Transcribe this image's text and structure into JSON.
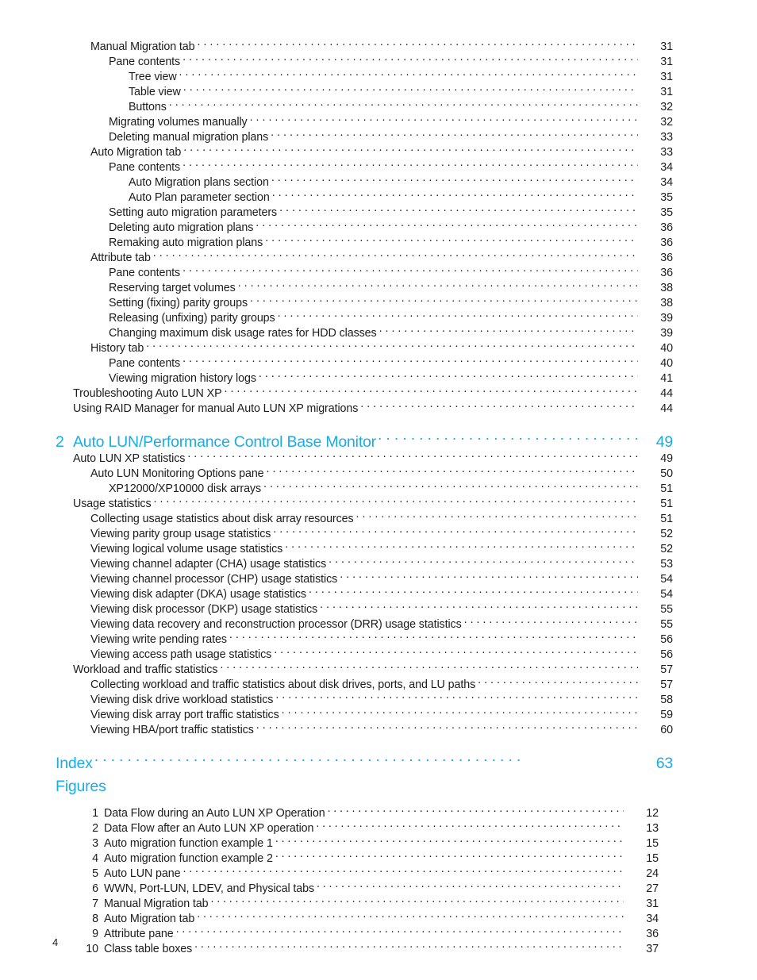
{
  "document": {
    "folio": "4",
    "accent_color": "#18AEE4",
    "text_color": "#1c1c1c"
  },
  "toc": {
    "entries": [
      {
        "level": 1,
        "label": "Manual Migration tab",
        "page": "31"
      },
      {
        "level": 2,
        "label": "Pane contents",
        "page": "31"
      },
      {
        "level": 3,
        "label": "Tree view",
        "page": "31"
      },
      {
        "level": 3,
        "label": "Table view",
        "page": "31"
      },
      {
        "level": 3,
        "label": "Buttons",
        "page": "32"
      },
      {
        "level": 2,
        "label": "Migrating volumes manually",
        "page": "32"
      },
      {
        "level": 2,
        "label": "Deleting manual migration plans",
        "page": "33"
      },
      {
        "level": 1,
        "label": "Auto Migration tab",
        "page": "33"
      },
      {
        "level": 2,
        "label": "Pane contents",
        "page": "34"
      },
      {
        "level": 3,
        "label": "Auto Migration plans section",
        "page": "34"
      },
      {
        "level": 3,
        "label": "Auto Plan parameter section",
        "page": "35"
      },
      {
        "level": 2,
        "label": "Setting auto migration parameters",
        "page": "35"
      },
      {
        "level": 2,
        "label": "Deleting auto migration plans",
        "page": "36"
      },
      {
        "level": 2,
        "label": "Remaking auto migration plans",
        "page": "36"
      },
      {
        "level": 1,
        "label": "Attribute tab",
        "page": "36"
      },
      {
        "level": 2,
        "label": "Pane contents",
        "page": "36"
      },
      {
        "level": 2,
        "label": "Reserving target volumes",
        "page": "38"
      },
      {
        "level": 2,
        "label": "Setting (fixing) parity groups",
        "page": "38"
      },
      {
        "level": 2,
        "label": "Releasing (unfixing) parity groups",
        "page": "39"
      },
      {
        "level": 2,
        "label": "Changing maximum disk usage rates for HDD classes",
        "page": "39"
      },
      {
        "level": 1,
        "label": "History tab",
        "page": "40"
      },
      {
        "level": 2,
        "label": "Pane contents",
        "page": "40"
      },
      {
        "level": 2,
        "label": "Viewing migration history logs",
        "page": "41"
      },
      {
        "level": 0,
        "label": "Troubleshooting Auto LUN XP",
        "page": "44"
      },
      {
        "level": 0,
        "label": "Using RAID Manager for manual Auto LUN XP migrations",
        "page": "44"
      }
    ],
    "chapter": {
      "number": "2",
      "label": "Auto LUN/Performance Control Base Monitor",
      "page": "49"
    },
    "entries2": [
      {
        "level": 0,
        "label": "Auto LUN XP statistics",
        "page": "49"
      },
      {
        "level": 1,
        "label": "Auto LUN Monitoring Options pane",
        "page": "50"
      },
      {
        "level": 2,
        "label": "XP12000/XP10000 disk arrays",
        "page": "51"
      },
      {
        "level": 0,
        "label": "Usage statistics",
        "page": "51"
      },
      {
        "level": 1,
        "label": "Collecting usage statistics about disk array resources",
        "page": "51"
      },
      {
        "level": 1,
        "label": "Viewing parity group usage statistics",
        "page": "52"
      },
      {
        "level": 1,
        "label": "Viewing logical volume usage statistics",
        "page": "52"
      },
      {
        "level": 1,
        "label": "Viewing channel adapter (CHA) usage statistics",
        "page": "53"
      },
      {
        "level": 1,
        "label": "Viewing channel processor (CHP) usage statistics",
        "page": "54"
      },
      {
        "level": 1,
        "label": "Viewing disk adapter (DKA) usage statistics",
        "page": "54"
      },
      {
        "level": 1,
        "label": "Viewing disk processor (DKP) usage statistics",
        "page": "55"
      },
      {
        "level": 1,
        "label": "Viewing data recovery and reconstruction processor (DRR) usage statistics",
        "page": "55"
      },
      {
        "level": 1,
        "label": "Viewing write pending rates",
        "page": "56"
      },
      {
        "level": 1,
        "label": "Viewing access path usage statistics",
        "page": "56"
      },
      {
        "level": 0,
        "label": "Workload and traffic statistics",
        "page": "57"
      },
      {
        "level": 1,
        "label": "Collecting workload and traffic statistics about disk drives, ports, and LU paths",
        "page": "57"
      },
      {
        "level": 1,
        "label": "Viewing disk drive workload statistics",
        "page": "58"
      },
      {
        "level": 1,
        "label": "Viewing disk array port traffic statistics",
        "page": "59"
      },
      {
        "level": 1,
        "label": "Viewing HBA/port traffic statistics",
        "page": "60"
      }
    ],
    "index": {
      "label": "Index",
      "page": "63"
    },
    "figures_heading": "Figures",
    "figures": [
      {
        "num": "1",
        "label": "Data Flow during an Auto LUN XP Operation",
        "page": "12"
      },
      {
        "num": "2",
        "label": "Data Flow after an Auto LUN XP operation",
        "page": "13"
      },
      {
        "num": "3",
        "label": "Auto migration function example 1",
        "page": "15"
      },
      {
        "num": "4",
        "label": "Auto migration function example 2",
        "page": "15"
      },
      {
        "num": "5",
        "label": "Auto LUN pane",
        "page": "24"
      },
      {
        "num": "6",
        "label": "WWN, Port-LUN, LDEV, and Physical tabs",
        "page": "27"
      },
      {
        "num": "7",
        "label": "Manual Migration tab",
        "page": "31"
      },
      {
        "num": "8",
        "label": "Auto Migration tab",
        "page": "34"
      },
      {
        "num": "9",
        "label": "Attribute pane",
        "page": "36"
      },
      {
        "num": "10",
        "label": "Class table boxes",
        "page": "37"
      }
    ]
  }
}
